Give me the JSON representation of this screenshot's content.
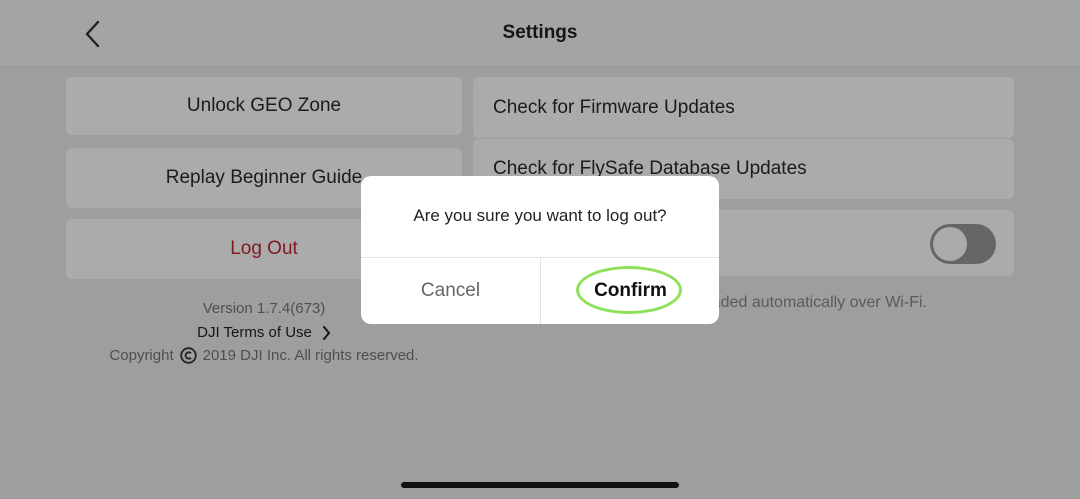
{
  "header": {
    "title": "Settings",
    "back_icon": "chevron-left-icon"
  },
  "left_panel": {
    "unlock_geo_zone": "Unlock GEO Zone",
    "replay_beginner_guide": "Replay Beginner Guide",
    "log_out": "Log Out",
    "version": "Version 1.7.4(673)",
    "terms_of_use": "DJI Terms of Use",
    "copyright_prefix": "Copyright",
    "copyright_text": "2019 DJI Inc. All rights reserved."
  },
  "right_panel": {
    "check_firmware_updates": "Check for Firmware Updates",
    "check_flysafe_updates": "Check for FlySafe Database Updates",
    "auto_download_toggle": "off",
    "auto_download_desc": "rmware updates will be downloaded automatically over Wi-Fi."
  },
  "dialog": {
    "message": "Are you sure you want to log out?",
    "cancel_label": "Cancel",
    "confirm_label": "Confirm"
  },
  "colors": {
    "logout": "#c0262d",
    "highlight_ring": "#8ee05a",
    "toggle_off": "#999999"
  }
}
